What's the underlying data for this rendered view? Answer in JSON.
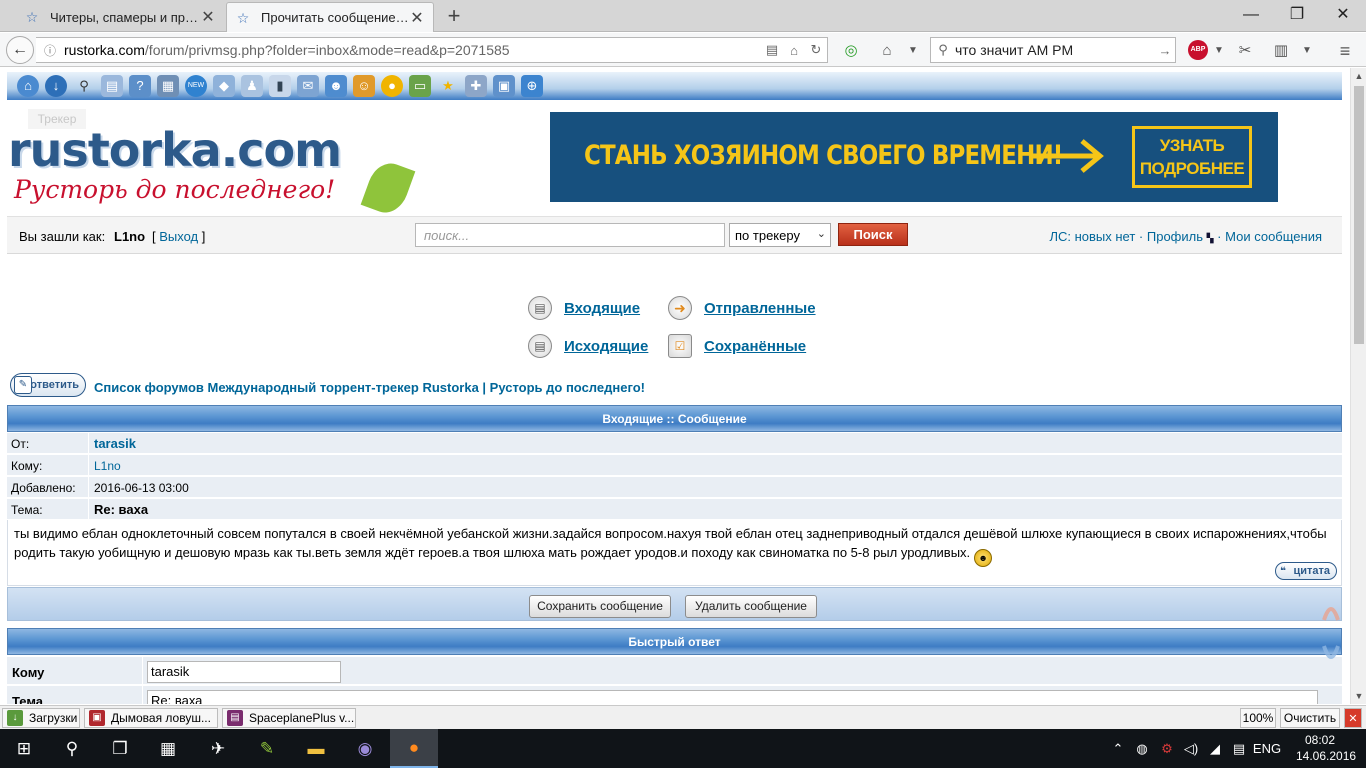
{
  "browser": {
    "tabs": [
      {
        "title": "Читеры, спамеры и проч..."
      },
      {
        "title": "Прочитать сообщение :: ..."
      }
    ],
    "url_domain": "rustorka.com",
    "url_path": "/forum/privmsg.php?folder=inbox&mode=read&p=2071585",
    "search_value": "что значит AM PM"
  },
  "site": {
    "logo_brand": "rustorka.com",
    "logo_tagline": "Русторь до последнего!",
    "tracker_tip": "Трекер",
    "banner_text": "СТАНЬ ХОЗЯИНОМ СВОЕГО ВРЕМЕНИ!",
    "banner_button_line1": "УЗНАТЬ",
    "banner_button_line2": "ПОДРОБНЕЕ",
    "login_label": "Вы зашли как:",
    "username": "L1no",
    "logout_open": "[ ",
    "logout_label": "Выход",
    "logout_close": " ]",
    "search_placeholder": "поиск...",
    "search_scope": "по трекеру",
    "search_button": "Поиск",
    "pm_status": "ЛС: новых нет",
    "sep": " · ",
    "profile_link": "Профиль",
    "my_messages_link": "Мои сообщения"
  },
  "folders": {
    "inbox": "Входящие",
    "sent": "Отправленные",
    "outbox": "Исходящие",
    "saved": "Сохранённые"
  },
  "reply_button": "ответить",
  "breadcrumb": "Список форумов Международный торрент-трекер Rustorka | Русторь до последнего!",
  "message": {
    "header": "Входящие :: Сообщение",
    "from_label": "От:",
    "from_value": "tarasik",
    "to_label": "Кому:",
    "to_value": "L1no",
    "added_label": "Добавлено:",
    "added_value": "2016-06-13 03:00",
    "subject_label": "Тема:",
    "subject_value": "Re: ваха",
    "body": "ты видимо еблан одноклеточный совсем попутался в своей некчёмной уебанской жизни.задайся вопросом.нахуя твой еблан отец заднеприводный отдался дешёвой шлюхе купающиеся в своих испарожнениях,чтобы родить такую уобищную и дешовую мразь как ты.веть земля ждёт героев.а твоя шлюха мать рождает уродов.и походу как свиноматка по 5-8 рыл уродливых.",
    "quote_button": "цитата",
    "save_button": "Сохранить сообщение",
    "delete_button": "Удалить сообщение"
  },
  "quick_reply": {
    "header": "Быстрый ответ",
    "to_label": "Кому",
    "to_value": "tarasik",
    "subject_label": "Тема",
    "subject_value": "Re: ваха"
  },
  "statusbar": {
    "downloads": "Загрузки",
    "task1": "Дымовая ловуш...",
    "task2": "SpaceplanePlus v...",
    "zoom": "100%",
    "clear": "Очистить"
  },
  "taskbar": {
    "lang": "ENG",
    "time": "08:02",
    "date": "14.06.2016"
  },
  "colors": {
    "link": "#006699",
    "header_blue": "#3e7cc4",
    "search_button": "#c8402a",
    "banner_bg": "#17507e",
    "banner_yellow": "#f5c518"
  }
}
